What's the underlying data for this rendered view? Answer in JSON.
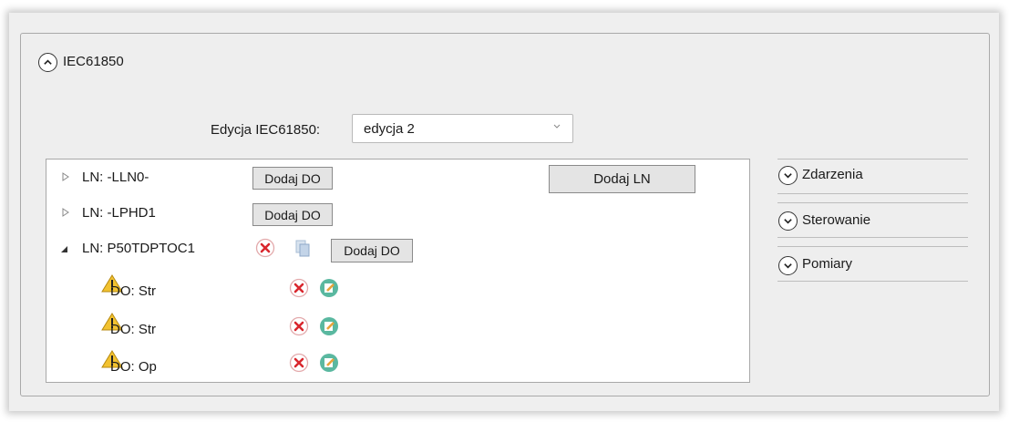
{
  "header": {
    "title": "IEC61850"
  },
  "edition": {
    "label": "Edycja IEC61850:",
    "selected": "edycja 2"
  },
  "tree": {
    "add_ln_button": "Dodaj LN",
    "nodes": [
      {
        "label": "LN: -LLN0-",
        "add_do": "Dodaj DO"
      },
      {
        "label": "LN: -LPHD1",
        "add_do": "Dodaj DO"
      },
      {
        "label": "LN: P50TDPTOC1",
        "add_do": "Dodaj DO",
        "children": [
          {
            "label": "DO: Str"
          },
          {
            "label": "DO: Str"
          },
          {
            "label": "DO: Op"
          }
        ]
      }
    ]
  },
  "side_panels": [
    {
      "label": "Zdarzenia"
    },
    {
      "label": "Sterowanie"
    },
    {
      "label": "Pomiary"
    }
  ],
  "colors": {
    "delete_icon": "#d9272e",
    "edit_icon": "#5ab8a0",
    "warning_icon": "#f2c230"
  }
}
